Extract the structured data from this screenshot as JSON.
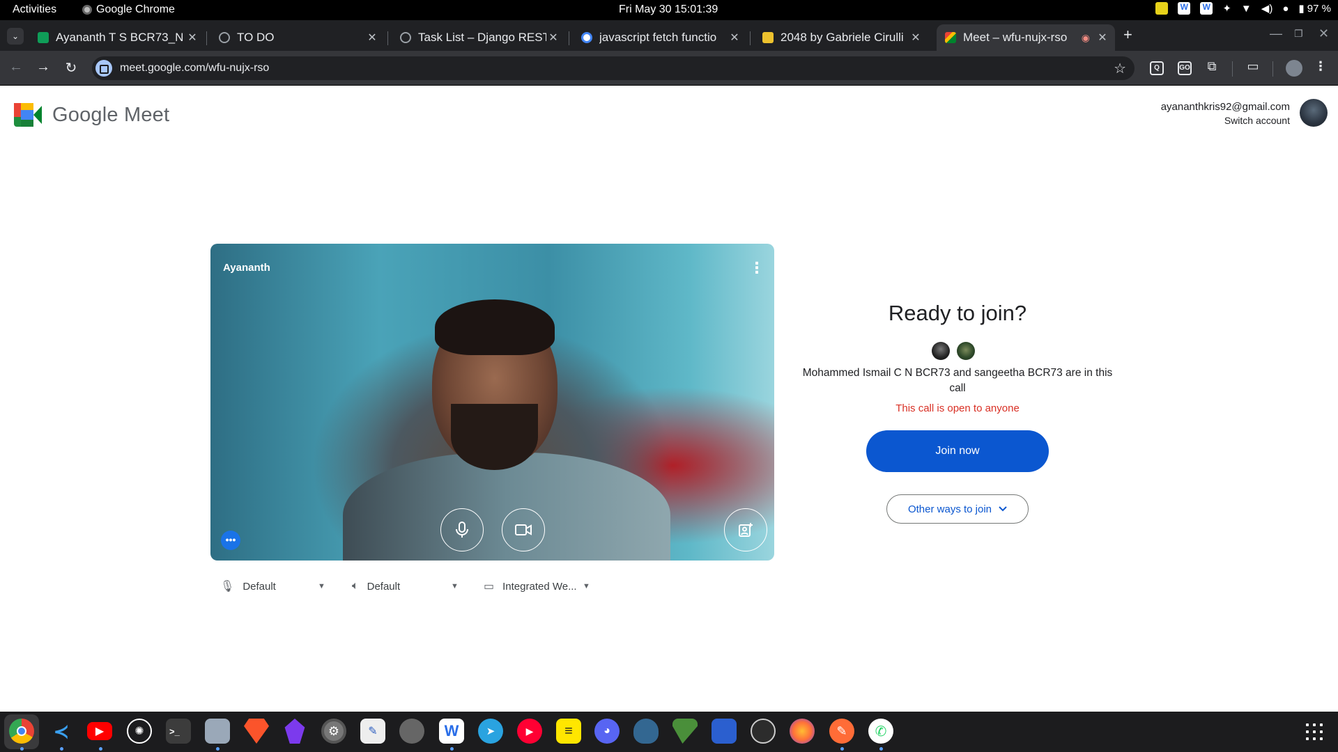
{
  "topbar": {
    "activities": "Activities",
    "app_name": "Google Chrome",
    "clock": "Fri May 30  15:01:39",
    "battery": "97 %"
  },
  "tabs": [
    {
      "title": "Ayananth T S BCR73_N",
      "favicon": "sheets-icon",
      "color": "#0f9d58"
    },
    {
      "title": "TO DO",
      "favicon": "globe-icon",
      "color": "#9aa0a6"
    },
    {
      "title": "Task List – Django REST",
      "favicon": "globe-icon",
      "color": "#9aa0a6"
    },
    {
      "title": "javascript fetch functio",
      "favicon": "google-icon",
      "color": "#4285f4"
    },
    {
      "title": "2048 by Gabriele Cirulli",
      "favicon": "2048-icon",
      "color": "#edc22e"
    },
    {
      "title": "Meet – wfu-nujx-rso",
      "favicon": "meet-icon",
      "color": "#00832d"
    }
  ],
  "toolbar": {
    "url": "meet.google.com/wfu-nujx-rso"
  },
  "meet": {
    "product": "Google Meet",
    "account_email": "ayananthkris92@gmail.com",
    "switch_account": "Switch account",
    "self_name": "Ayananth",
    "ready_title": "Ready to join?",
    "in_call_text": "Mohammed Ismail C N BCR73 and sangeetha BCR73 are in this call",
    "open_notice": "This call is open to anyone",
    "join_label": "Join now",
    "other_ways_label": "Other ways to join",
    "devices": {
      "mic": "Default",
      "speaker": "Default",
      "camera": "Integrated We..."
    }
  },
  "colors": {
    "join_button": "#0b57d0",
    "open_notice": "#d93025",
    "tab_strip": "#202124"
  },
  "dock": [
    "chrome-icon",
    "vscode-icon",
    "youtube-icon",
    "chatgpt-icon",
    "terminal-icon",
    "files-icon",
    "brave-icon",
    "obsidian-icon",
    "settings-icon",
    "text-editor-icon",
    "clock-icon",
    "wps-writer-icon",
    "telegram-icon",
    "youtube-music-icon",
    "sticky-notes-icon",
    "discord-icon",
    "postgresql-icon",
    "vim-icon",
    "wps-office-icon",
    "obs-icon",
    "firefox-icon",
    "postman-icon",
    "whatsapp-icon"
  ]
}
